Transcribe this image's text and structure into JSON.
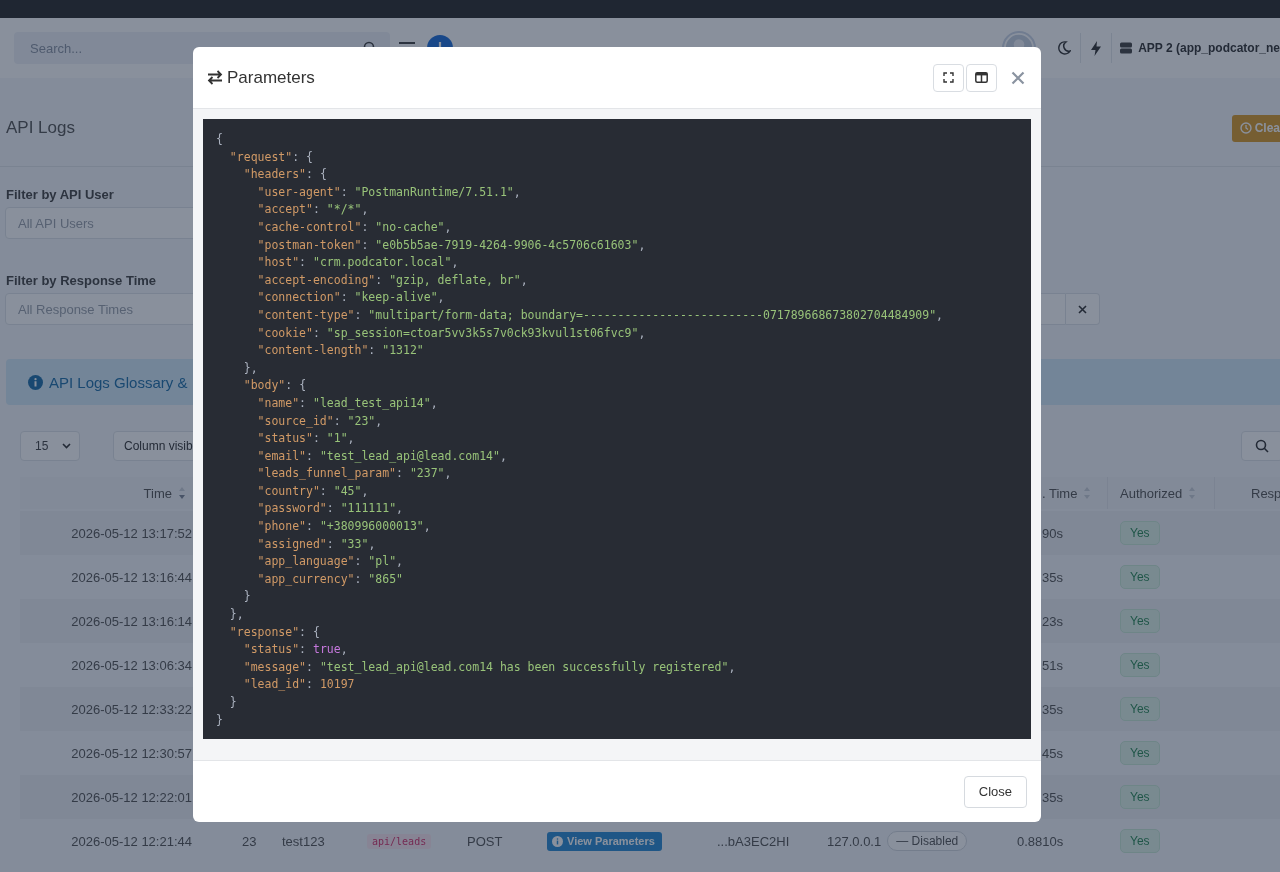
{
  "top_bar": {
    "search": {
      "placeholder": "Search..."
    },
    "app_switcher": "APP 2 (app_podcator_ne"
  },
  "page": {
    "title": "API Logs",
    "clear_button": "Clea"
  },
  "filters": [
    {
      "label": "Filter by API User",
      "placeholder": "All API Users",
      "clearable": false
    },
    {
      "label": "Filter by Response Time",
      "placeholder": "All Response Times",
      "clearable": true
    }
  ],
  "glossary_banner": "API Logs Glossary &",
  "table_controls": {
    "page_size": "15",
    "column_button": "Column visib"
  },
  "table": {
    "columns": [
      {
        "label": "Time",
        "sortable": true,
        "sorted": true
      },
      {
        "label": ". Time",
        "sortable": true,
        "sorted": false
      },
      {
        "label": "Authorized",
        "sortable": true,
        "sorted": false
      },
      {
        "label": "Resp",
        "sortable": false
      }
    ],
    "rows": [
      {
        "time": "2026-05-12 13:17:52",
        "resp_time": "90s",
        "authorized": "Yes"
      },
      {
        "time": "2026-05-12 13:16:44",
        "resp_time": "35s",
        "authorized": "Yes"
      },
      {
        "time": "2026-05-12 13:16:14",
        "resp_time": "23s",
        "authorized": "Yes"
      },
      {
        "time": "2026-05-12 13:06:34",
        "resp_time": "51s",
        "authorized": "Yes"
      },
      {
        "time": "2026-05-12 12:33:22",
        "resp_time": "35s",
        "authorized": "Yes"
      },
      {
        "time": "2026-05-12 12:30:57",
        "resp_time": "45s",
        "authorized": "Yes"
      },
      {
        "time": "2026-05-12 12:22:01",
        "resp_time": "35s",
        "authorized": "Yes"
      },
      {
        "time": "2026-05-12 12:21:44",
        "id": "23",
        "user": "test123",
        "endpoint": "api/leads",
        "method": "POST",
        "params_button": "View Parameters",
        "token": "...bA3EC2HI",
        "ip": "127.0.0.1",
        "ip_status": "— Disabled",
        "resp_time": "0.8810s",
        "authorized": "Yes"
      }
    ]
  },
  "modal": {
    "title": "Parameters",
    "close_button": "Close",
    "code_lines": [
      "{",
      "  \"request\": {",
      "    \"headers\": {",
      "      \"user-agent\": \"PostmanRuntime/7.51.1\",",
      "      \"accept\": \"*/*\",",
      "      \"cache-control\": \"no-cache\",",
      "      \"postman-token\": \"e0b5b5ae-7919-4264-9906-4c5706c61603\",",
      "      \"host\": \"crm.podcator.local\",",
      "      \"accept-encoding\": \"gzip, deflate, br\",",
      "      \"connection\": \"keep-alive\",",
      "      \"content-type\": \"multipart/form-data; boundary=--------------------------071789668673802704484909\",",
      "      \"cookie\": \"sp_session=ctoar5vv3k5s7v0ck93kvul1st06fvc9\",",
      "      \"content-length\": \"1312\"",
      "    },",
      "    \"body\": {",
      "      \"name\": \"lead_test_api14\",",
      "      \"source_id\": \"23\",",
      "      \"status\": \"1\",",
      "      \"email\": \"test_lead_api@lead.com14\",",
      "      \"leads_funnel_param\": \"237\",",
      "      \"country\": \"45\",",
      "      \"password\": \"111111\",",
      "      \"phone\": \"+380996000013\",",
      "      \"assigned\": \"33\",",
      "      \"app_language\": \"pl\",",
      "      \"app_currency\": \"865\"",
      "    }",
      "  },",
      "  \"response\": {",
      "    \"status\": true,",
      "    \"message\": \"test_lead_api@lead.com14 has been successfully registered\",",
      "    \"lead_id\": 10197",
      "  }",
      "}"
    ]
  }
}
